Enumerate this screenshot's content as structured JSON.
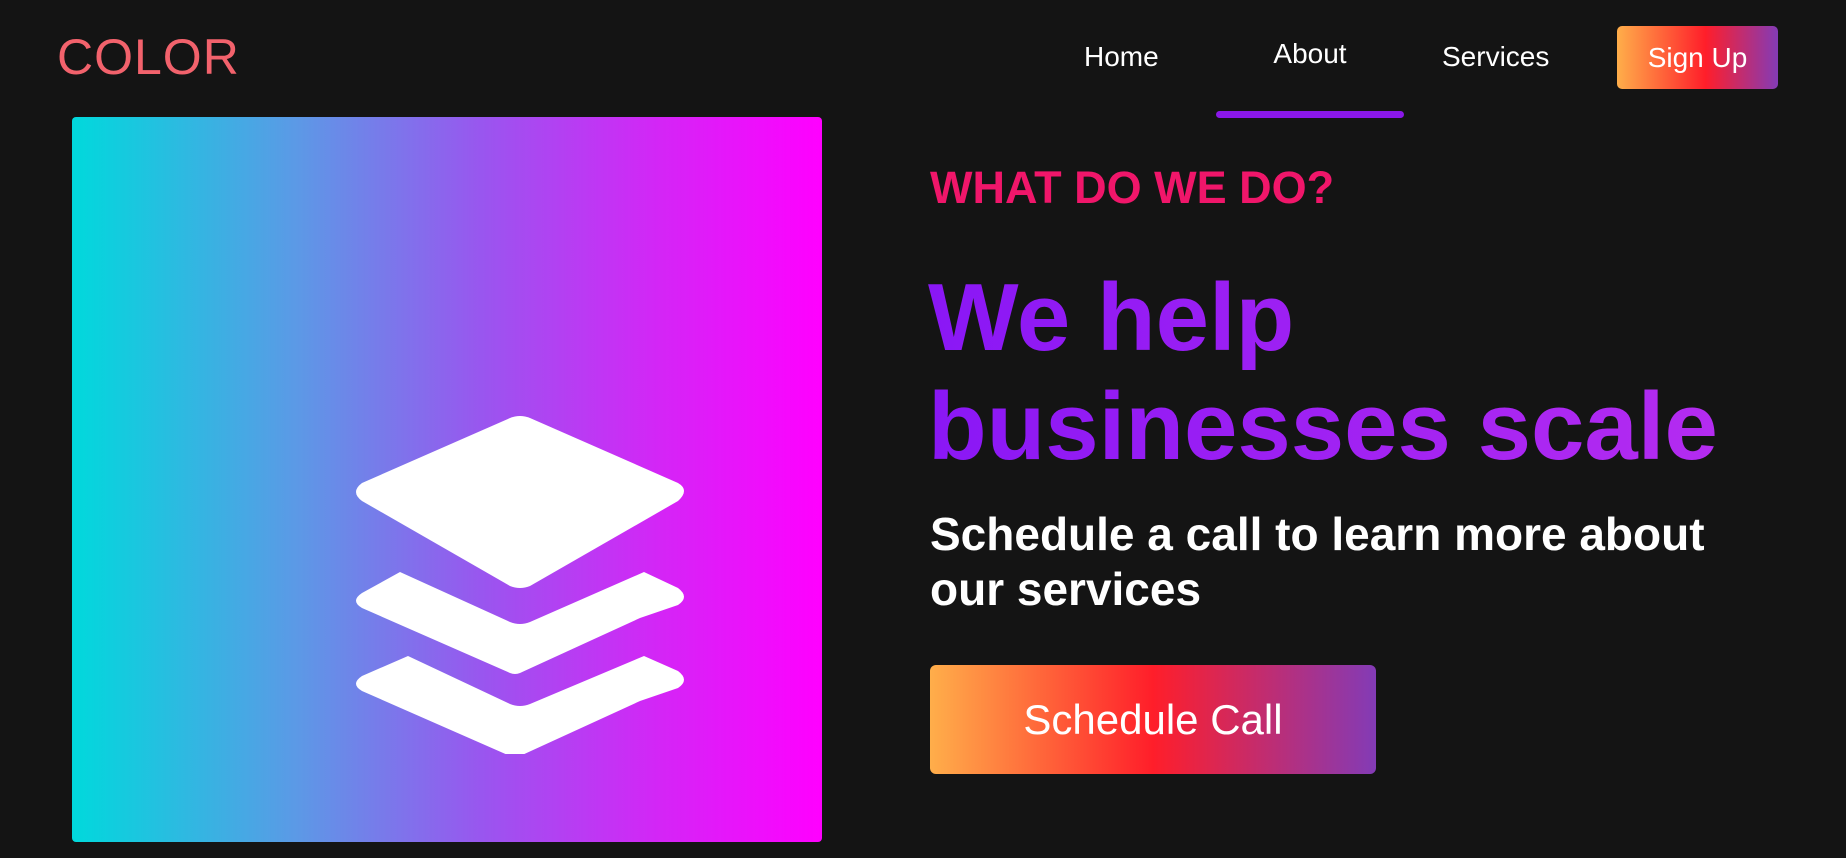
{
  "navbar": {
    "logo": "COLOR",
    "links": [
      {
        "label": "Home",
        "active": false
      },
      {
        "label": "About",
        "active": true
      },
      {
        "label": "Services",
        "active": false
      }
    ],
    "signup_label": "Sign Up"
  },
  "hero": {
    "icon": "layers-icon",
    "eyebrow": "WHAT DO WE DO?",
    "headline": "We help businesses scale",
    "subhead": "Schedule a call to learn more about our services",
    "cta_label": "Schedule Call"
  },
  "colors": {
    "background": "#141414",
    "logo": "#f2626c",
    "eyebrow": "#f0166a",
    "headline_start": "#8a17f5",
    "headline_end": "#b92ef0",
    "active_underline": "#8a17e8",
    "button_gradient": [
      "#ffae4a",
      "#ff1e2a",
      "#833bb6"
    ],
    "card_gradient": [
      "#00d9dc",
      "#ff00ff"
    ]
  }
}
